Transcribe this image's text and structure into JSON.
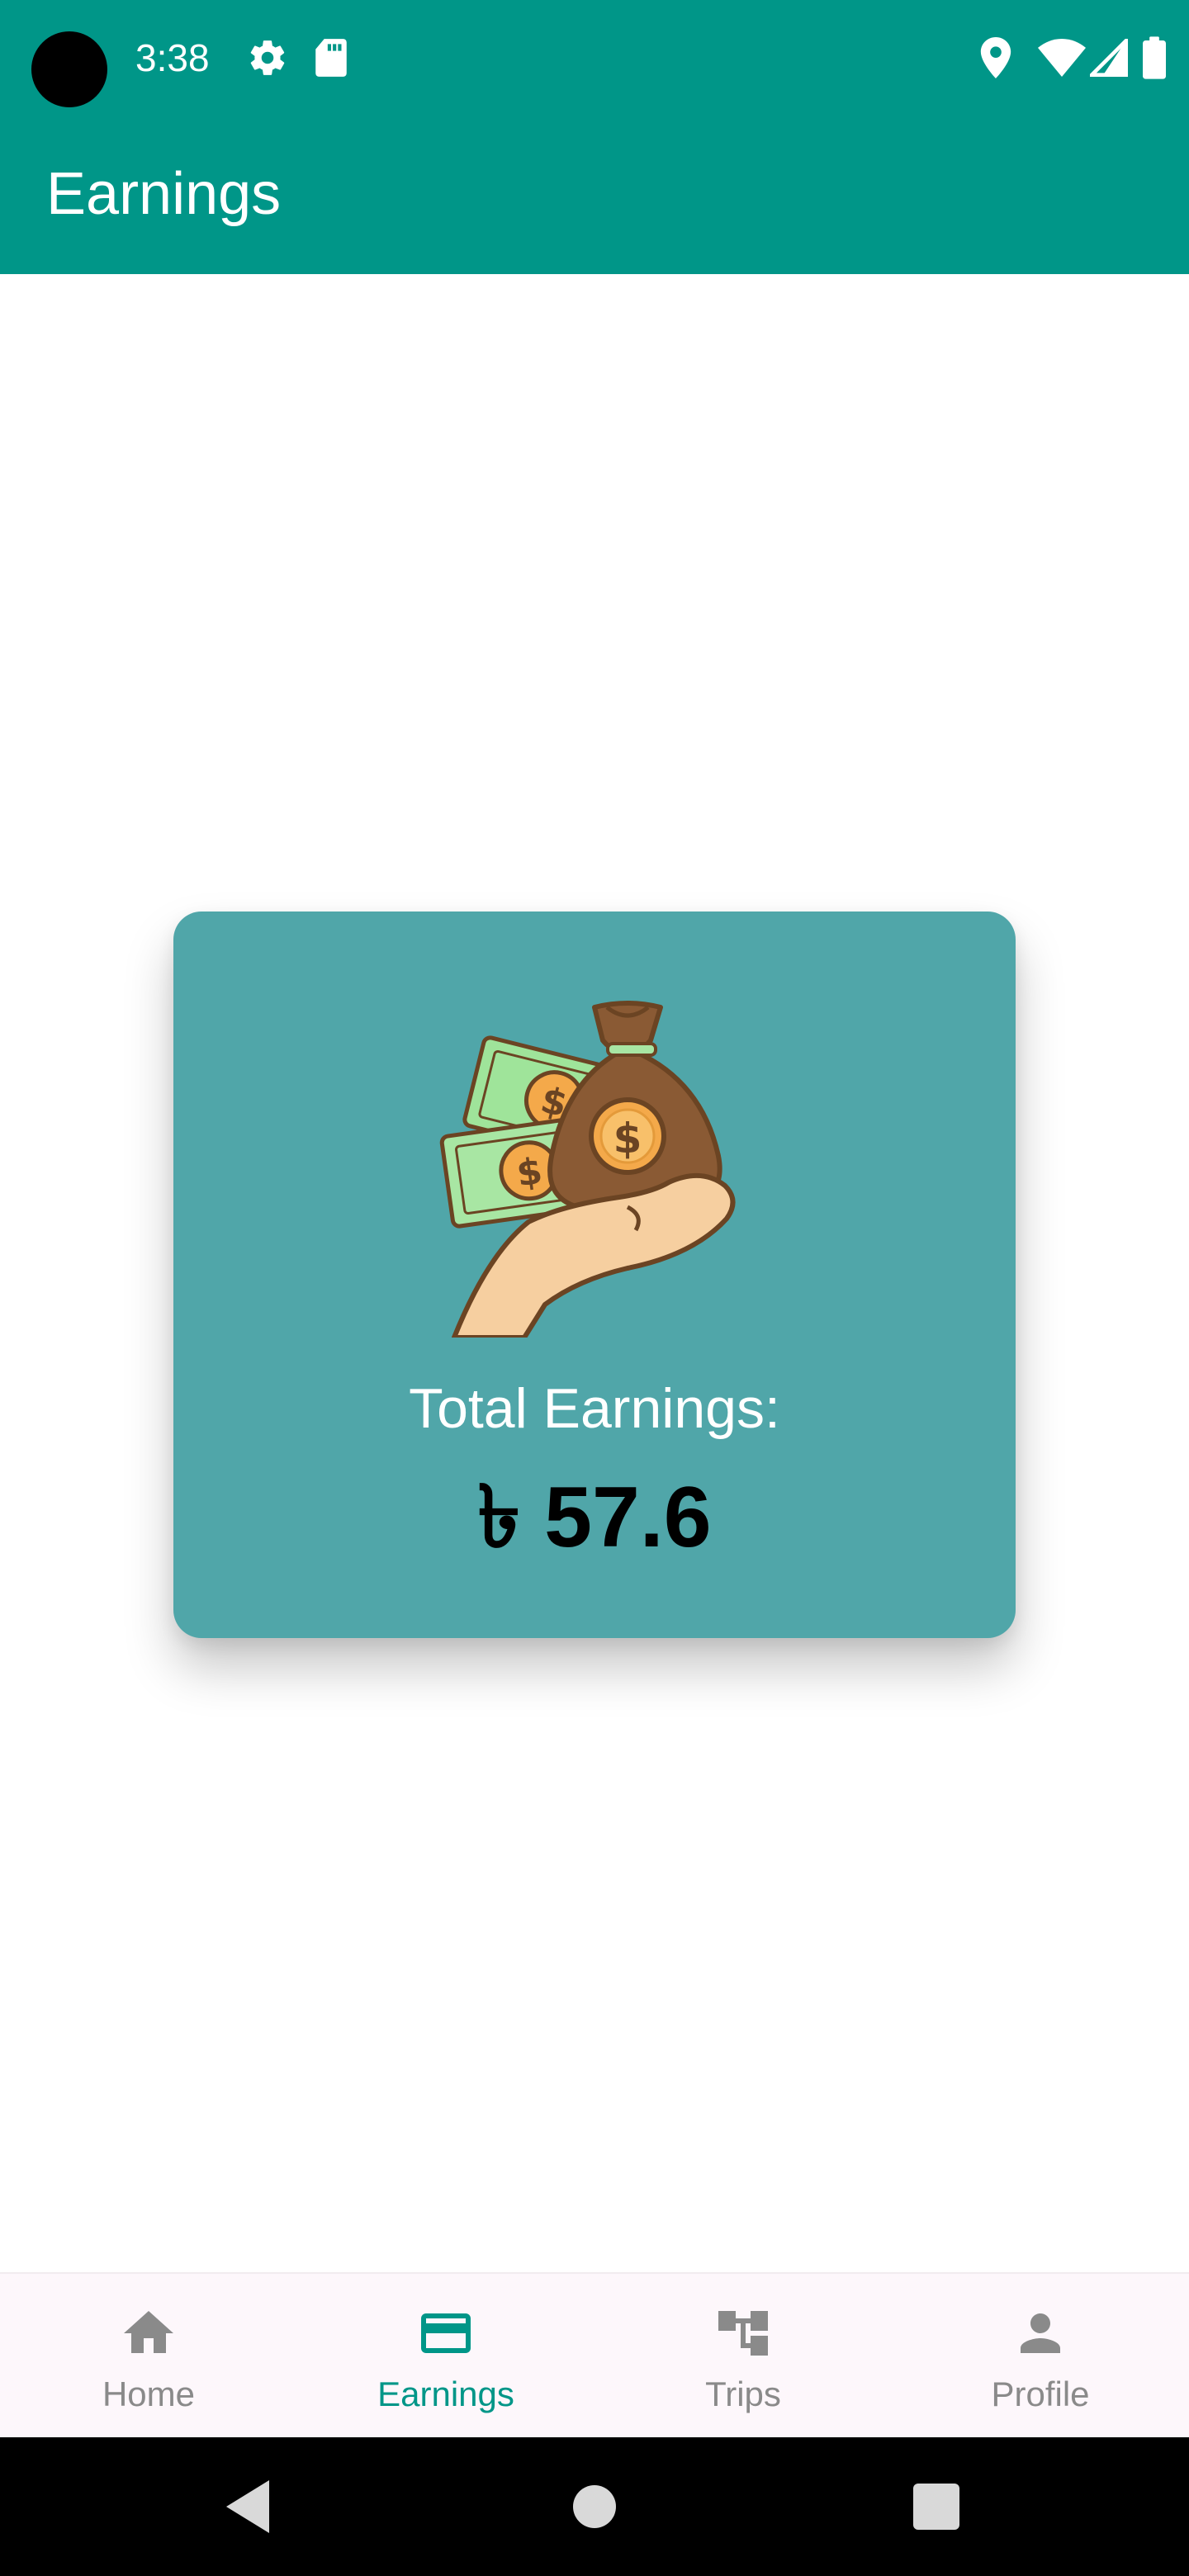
{
  "status_bar": {
    "time": "3:38",
    "icons_left": [
      "settings-icon",
      "sd-card-icon"
    ],
    "icons_right": [
      "location-icon",
      "wifi-icon",
      "signal-icon",
      "battery-icon"
    ]
  },
  "app_bar": {
    "title": "Earnings"
  },
  "earnings_card": {
    "illustration": "money-bag-hand-icon",
    "label": "Total Earnings:",
    "value": "৳ 57.6"
  },
  "bottom_nav": {
    "items": [
      {
        "label": "Home",
        "icon": "home-icon",
        "active": false
      },
      {
        "label": "Earnings",
        "icon": "card-icon",
        "active": true
      },
      {
        "label": "Trips",
        "icon": "trips-icon",
        "active": false
      },
      {
        "label": "Profile",
        "icon": "person-icon",
        "active": false
      }
    ]
  },
  "system_nav": {
    "buttons": [
      "back-icon",
      "home-circle-icon",
      "recents-icon"
    ]
  },
  "colors": {
    "primary": "#009688",
    "card": "#50a6a9",
    "nav_inactive": "#8a8a8a",
    "nav_background": "#fdf7fb"
  }
}
